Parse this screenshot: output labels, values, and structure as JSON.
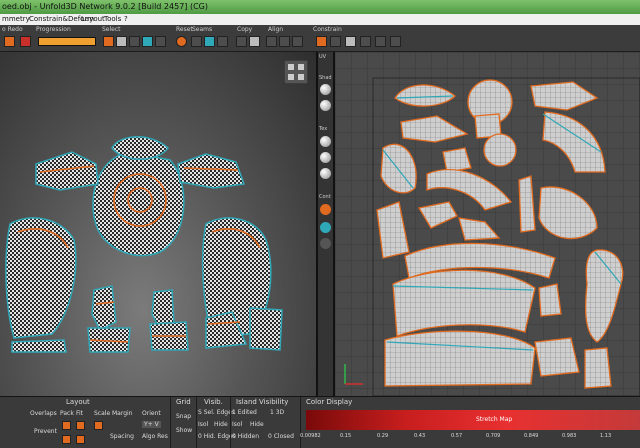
{
  "window": {
    "title": "oed.obj - Unfold3D Network 9.0.2 [Build 2457] (CG)"
  },
  "menu": [
    "mmetry",
    "Constrain&Deform",
    "Layout",
    "Tools",
    "?"
  ],
  "toolbar": {
    "groups": [
      {
        "label": "o Redo"
      },
      {
        "label": "Progression"
      },
      {
        "label": "Select"
      },
      {
        "label": "Reset"
      },
      {
        "label": "Seams"
      },
      {
        "label": "Copy"
      },
      {
        "label": "Align"
      },
      {
        "label": "Constrain"
      }
    ],
    "progress": 1.0
  },
  "uv_gutter": [
    "UV",
    "Shad",
    "Tex",
    "Cont"
  ],
  "bottom": {
    "layout": {
      "header": "Layout",
      "overlaps": "Overlaps",
      "prevent": "Prevent",
      "pack": "Pack",
      "fit": "Fit",
      "scale": "Scale",
      "margin": "Margin",
      "orient": "Orient",
      "orient_value": "Y+ V",
      "spacing": "Spacing",
      "algo_res": "Algo Res"
    },
    "grid": {
      "header": "Grid",
      "snap": "Snap",
      "show": "Show"
    },
    "visib": {
      "header": "Visib.",
      "sel_edges": "S Sel. Edges",
      "isol": "Isol",
      "hide": "Hide",
      "hid_edges": "0 Hid. Edges"
    },
    "island": {
      "header": "Island Visibility",
      "edited": "1 Edited",
      "hidden": "0 Hidden",
      "closed": "0 Closed",
      "count": "1 3D",
      "isol": "Isol",
      "hide": "Hide"
    },
    "color": {
      "header": "Color Display",
      "map_label": "Stretch Map",
      "ticks": [
        "0.00982",
        "0.15",
        "0.29",
        "0.43",
        "0.57",
        "0.709",
        "0.849",
        "0.983",
        "1.13"
      ]
    }
  },
  "colors": {
    "accent": "#e06a1f",
    "highlight": "#2fa8b8",
    "titlebar": "#6bb35d"
  }
}
